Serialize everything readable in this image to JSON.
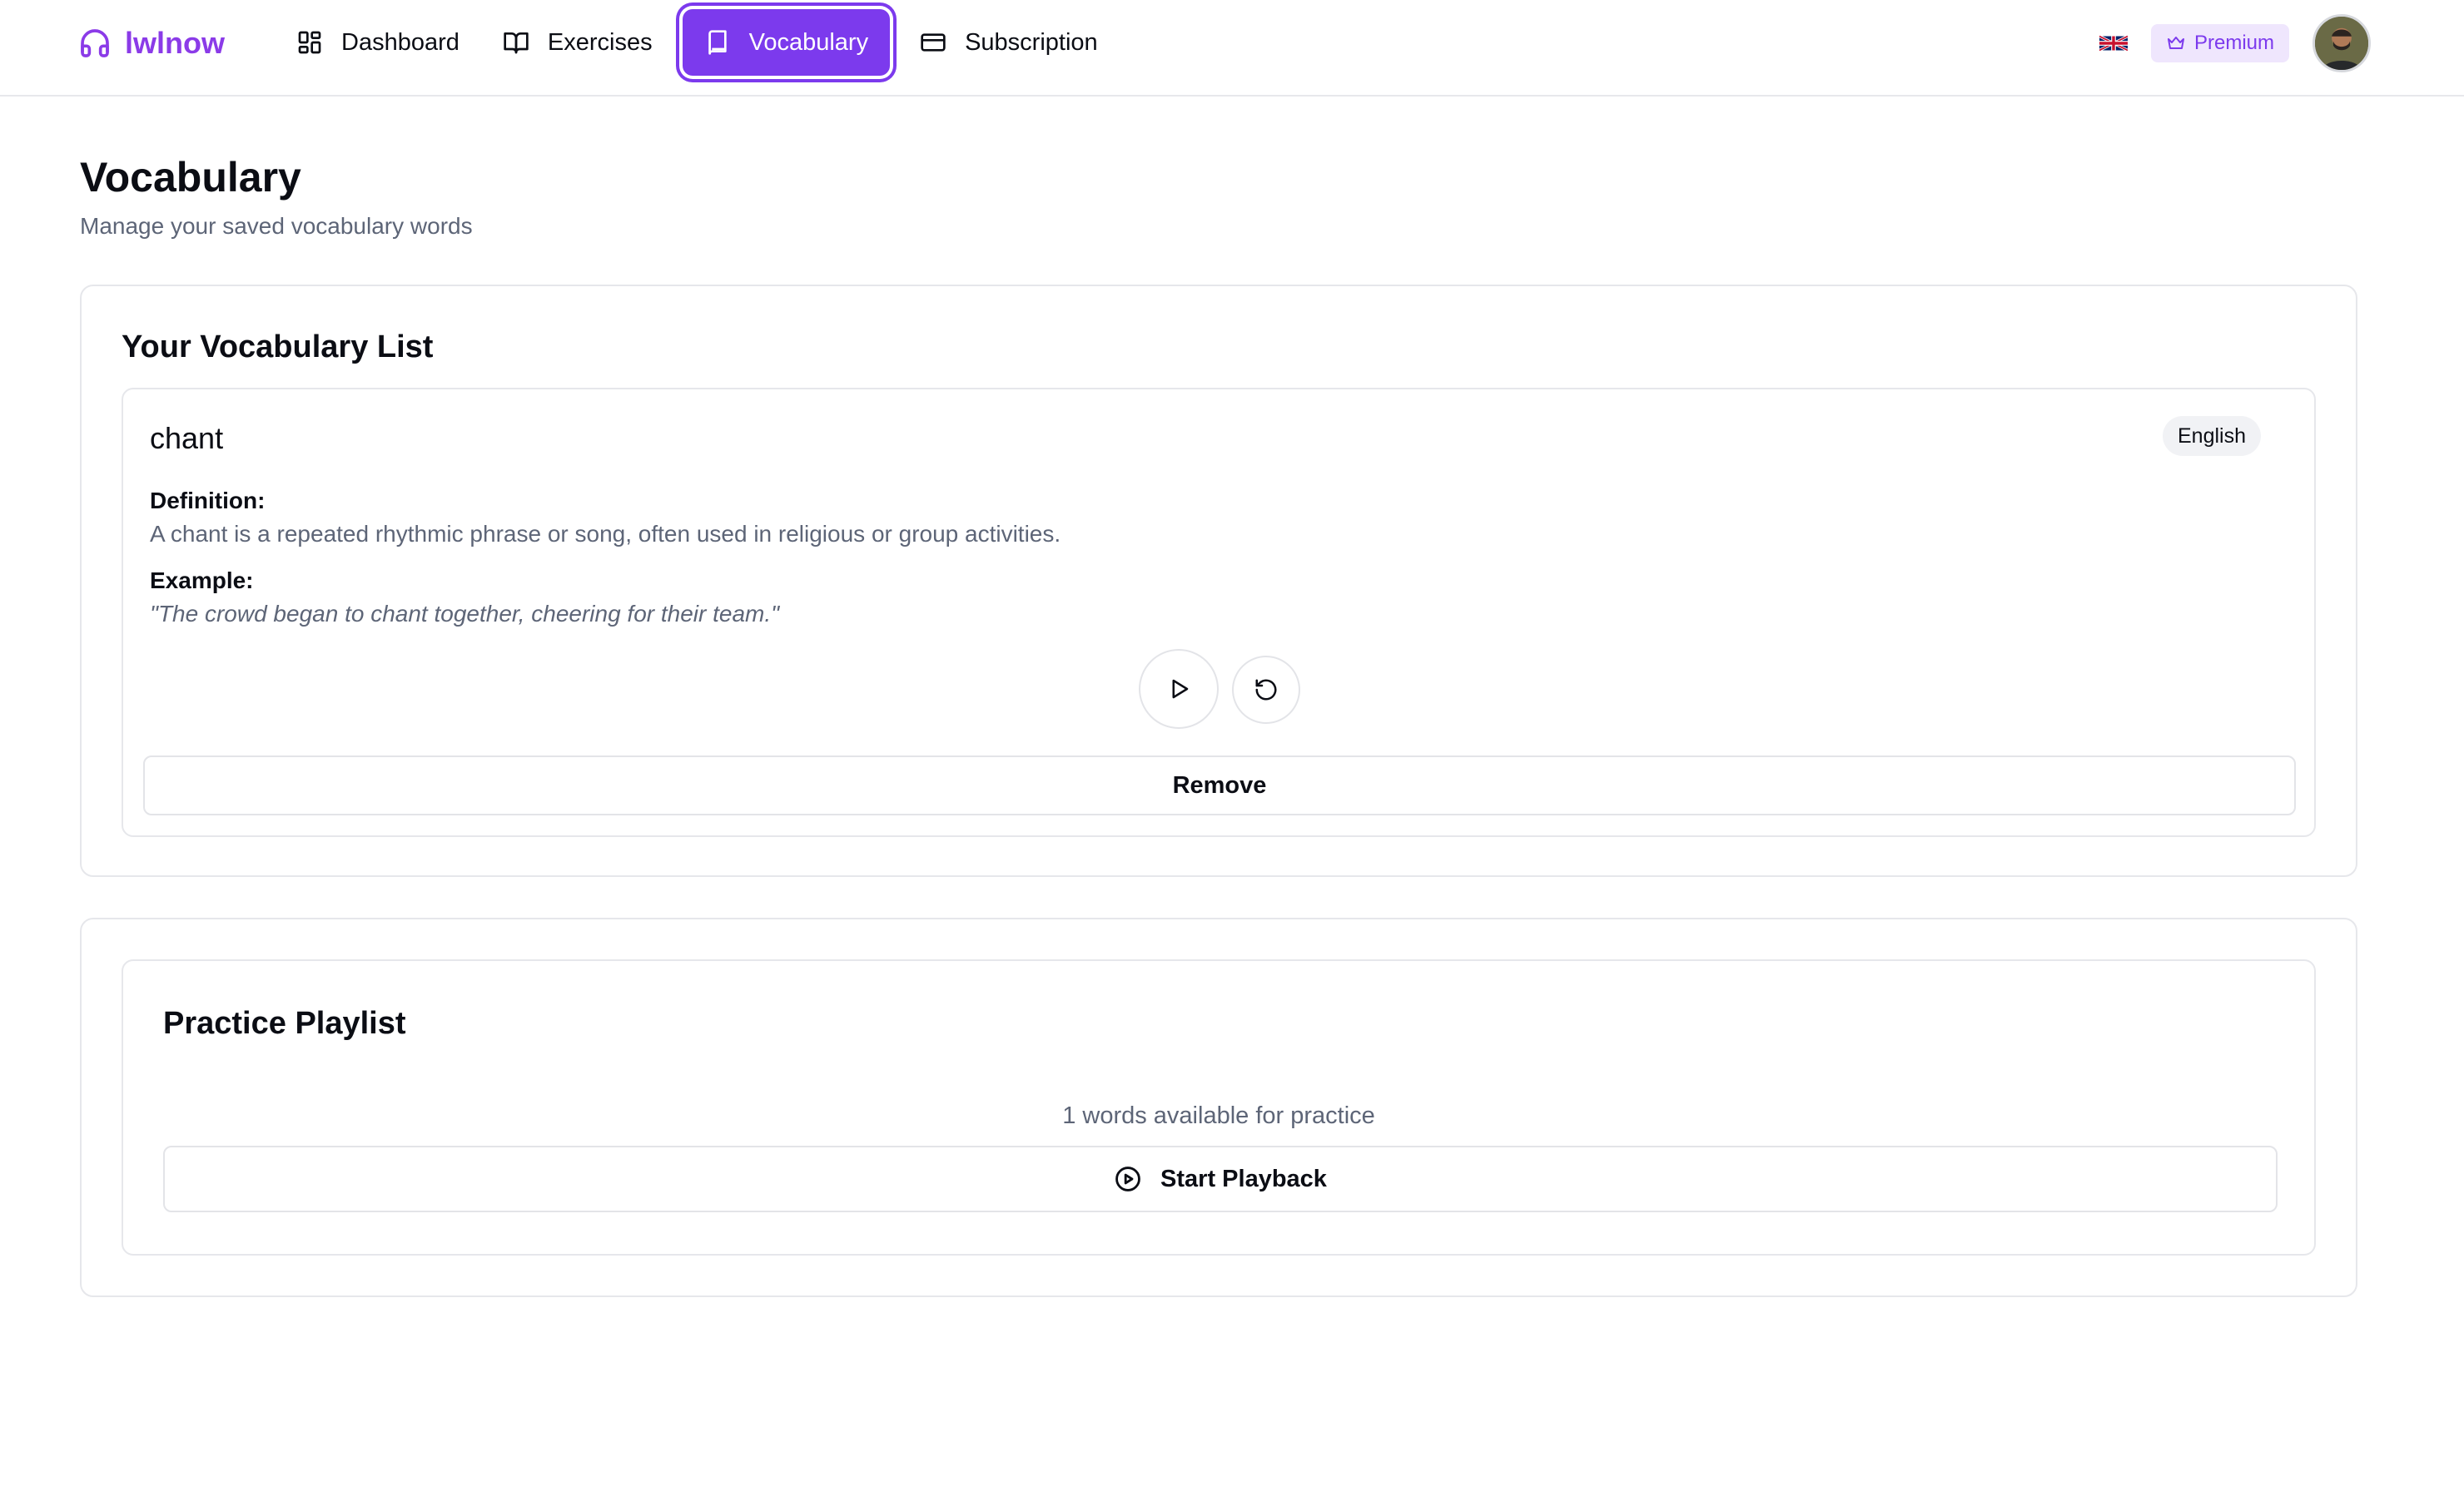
{
  "app": {
    "name": "lwlnow",
    "brand_color": "#8b3be8",
    "accent_color": "#7c3aed"
  },
  "nav": {
    "items": [
      {
        "label": "Dashboard",
        "icon": "dashboard-grid-icon",
        "active": false
      },
      {
        "label": "Exercises",
        "icon": "open-book-icon",
        "active": false
      },
      {
        "label": "Vocabulary",
        "icon": "book-icon",
        "active": true
      },
      {
        "label": "Subscription",
        "icon": "credit-card-icon",
        "active": false
      }
    ]
  },
  "header_right": {
    "language_flag": "uk-flag-icon",
    "premium_label": "Premium",
    "premium_icon": "crown-icon"
  },
  "page": {
    "title": "Vocabulary",
    "subtitle": "Manage your saved vocabulary words"
  },
  "vocab_list": {
    "title": "Your Vocabulary List",
    "entries": [
      {
        "word": "chant",
        "language": "English",
        "definition_label": "Definition:",
        "definition": "A chant is a repeated rhythmic phrase or song, often used in religious or group activities.",
        "example_label": "Example:",
        "example": "\"The crowd began to chant together, cheering for their team.\"",
        "remove_label": "Remove"
      }
    ]
  },
  "playlist": {
    "title": "Practice Playlist",
    "available_text": "1 words available for practice",
    "start_label": "Start Playback"
  }
}
